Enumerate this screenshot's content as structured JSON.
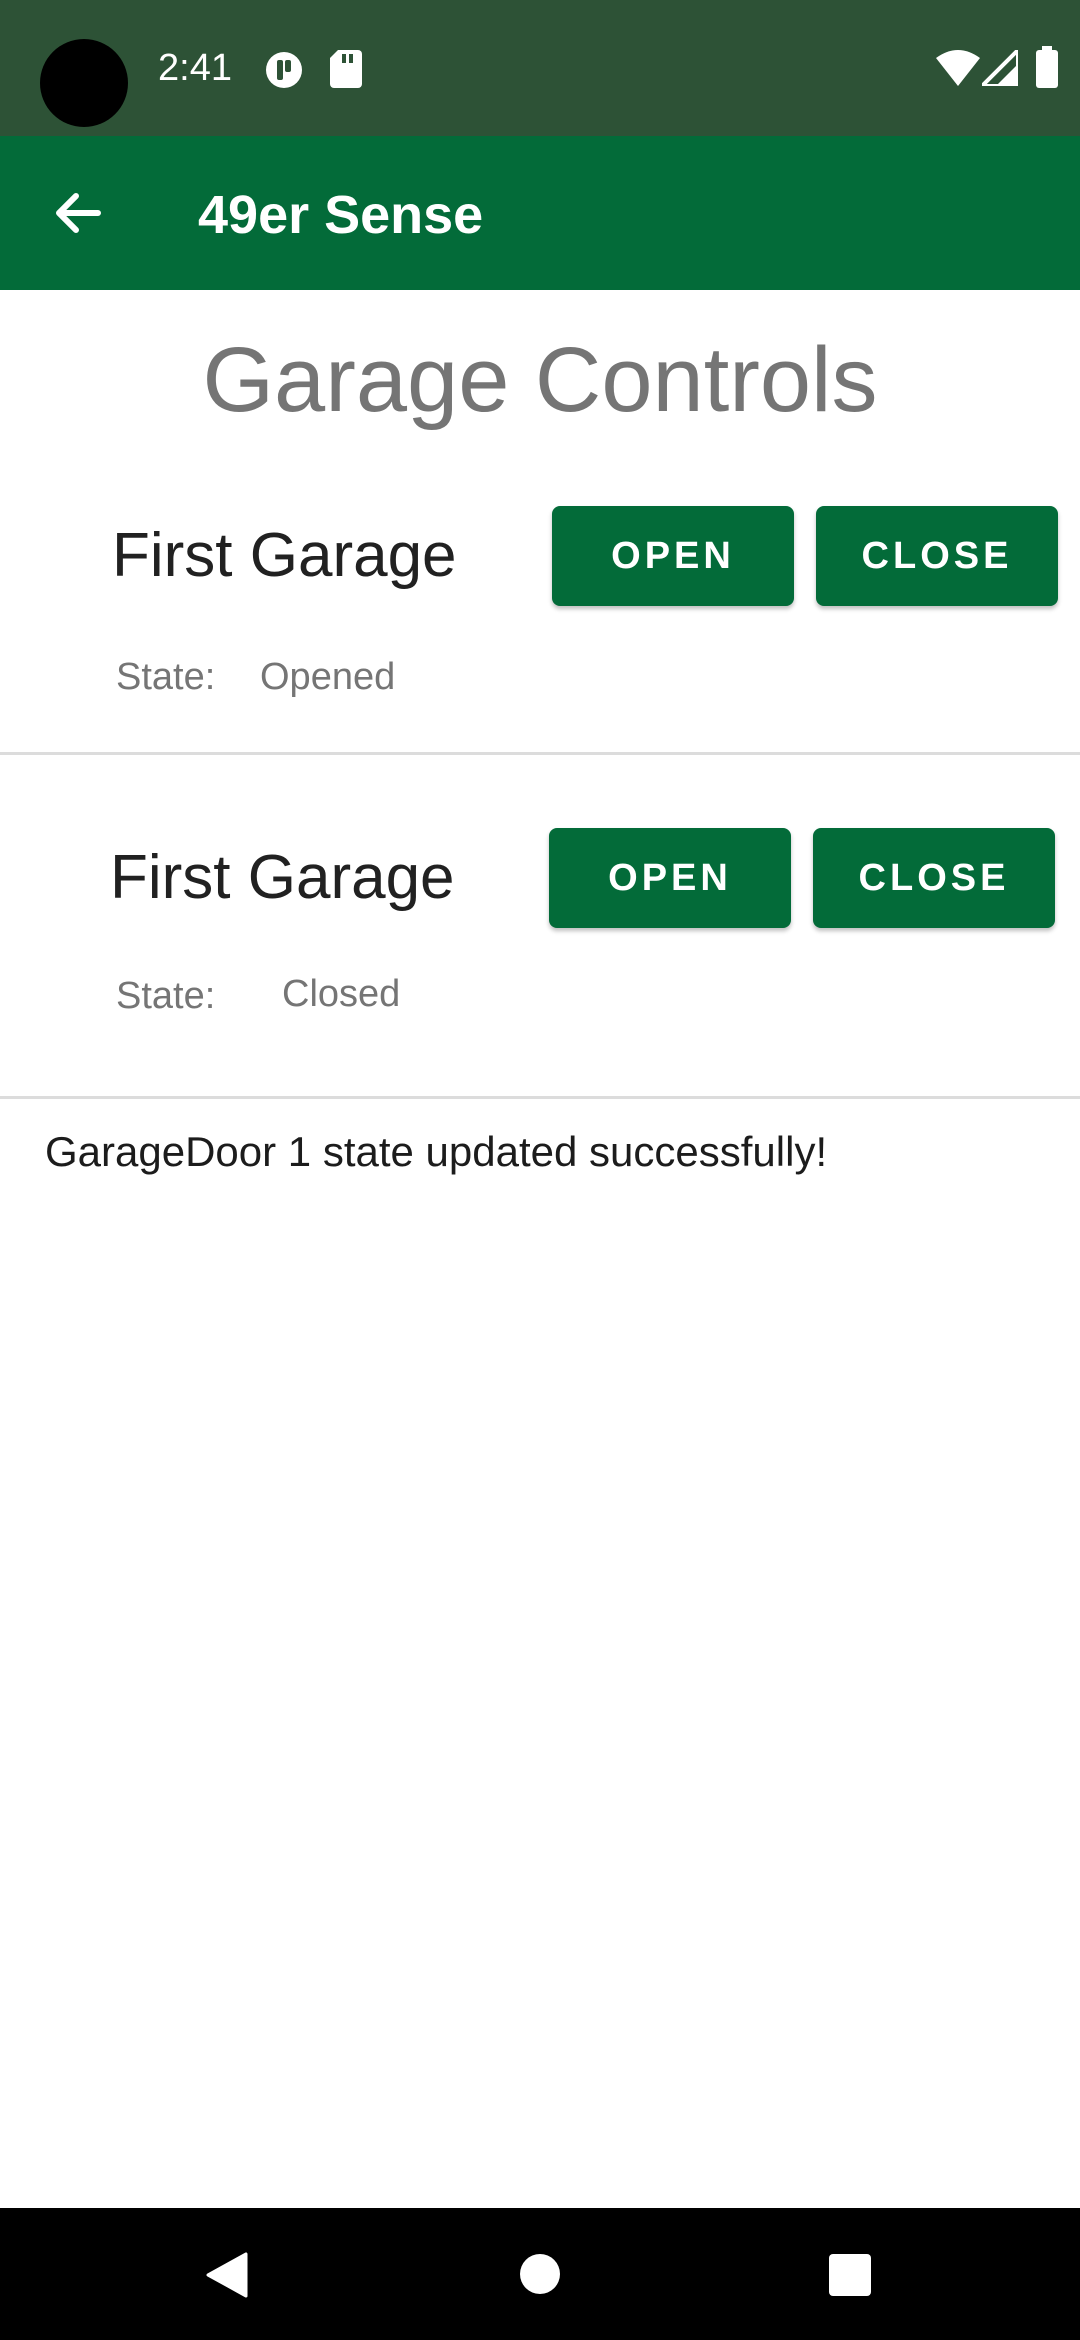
{
  "status_bar": {
    "time": "2:41",
    "icons": [
      "camera-cutout",
      "notification-icon",
      "sd-card-icon",
      "wifi-icon",
      "signal-icon",
      "battery-icon"
    ]
  },
  "app_bar": {
    "title": "49er Sense",
    "back_icon": "arrow-left-icon",
    "color": "#036b39"
  },
  "page": {
    "title": "Garage Controls"
  },
  "garages": [
    {
      "name": "First Garage",
      "open_label": "OPEN",
      "close_label": "CLOSE",
      "state_label": "State:",
      "state_value": "Opened"
    },
    {
      "name": "First Garage",
      "open_label": "OPEN",
      "close_label": "CLOSE",
      "state_label": "State:",
      "state_value": "Closed"
    }
  ],
  "message": "GarageDoor 1 state updated successfully!",
  "nav_bar": {
    "icons": [
      "back-triangle-icon",
      "home-circle-icon",
      "recents-square-icon"
    ]
  }
}
